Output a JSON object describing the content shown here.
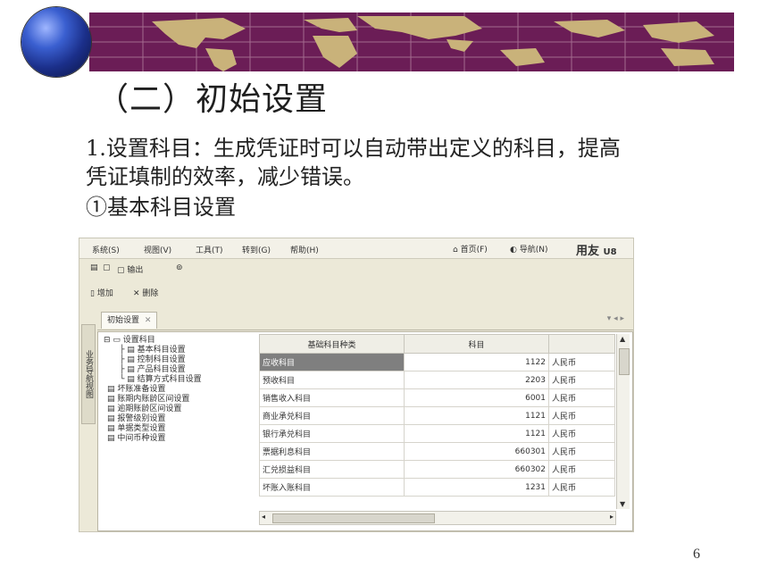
{
  "slide": {
    "title": "（二）初始设置",
    "line1": "1.设置科目：生成凭证时可以自动带出定义的科目，提高",
    "line2": "凭证填制的效率，减少错误。",
    "line3": "①基本科目设置",
    "page_number": "6"
  },
  "app": {
    "menus": [
      "系统(S)",
      "视图(V)",
      "工具(T)",
      "转到(G)",
      "帮助(H)"
    ],
    "right_links": [
      "首页(F)",
      "导航(N)"
    ],
    "brand": "用友",
    "toolbar1": {
      "output": "输出"
    },
    "toolbar2": {
      "add": "增加",
      "delete": "删除"
    },
    "tab": "初始设置",
    "side_tab": "业务导航视图",
    "tree": [
      "设置科目",
      "基本科目设置",
      "控制科目设置",
      "产品科目设置",
      "结算方式科目设置",
      "坏账准备设置",
      "账期内账龄区间设置",
      "逾期账龄区间设置",
      "报警级别设置",
      "单据类型设置",
      "中间币种设置"
    ],
    "grid": {
      "headers": [
        "基础科目种类",
        "科目",
        ""
      ],
      "rows": [
        {
          "name": "应收科目",
          "code": "1122",
          "currency": "人民币"
        },
        {
          "name": "预收科目",
          "code": "2203",
          "currency": "人民币"
        },
        {
          "name": "销售收入科目",
          "code": "6001",
          "currency": "人民币"
        },
        {
          "name": "商业承兑科目",
          "code": "1121",
          "currency": "人民币"
        },
        {
          "name": "银行承兑科目",
          "code": "1121",
          "currency": "人民币"
        },
        {
          "name": "票据利息科目",
          "code": "660301",
          "currency": "人民币"
        },
        {
          "name": "汇兑损益科目",
          "code": "660302",
          "currency": "人民币"
        },
        {
          "name": "坏账入账科目",
          "code": "1231",
          "currency": "人民币"
        }
      ]
    }
  },
  "colors": {
    "banner": "#6b1d56",
    "continents": "#c9b27a"
  }
}
